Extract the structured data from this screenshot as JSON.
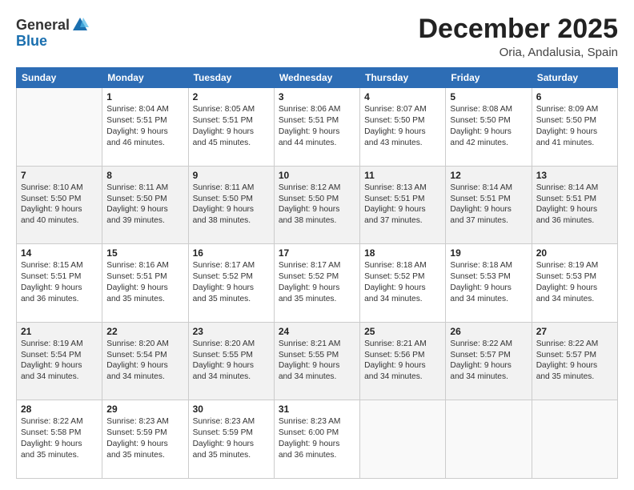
{
  "header": {
    "logo_general": "General",
    "logo_blue": "Blue",
    "month_title": "December 2025",
    "location": "Oria, Andalusia, Spain"
  },
  "weekdays": [
    "Sunday",
    "Monday",
    "Tuesday",
    "Wednesday",
    "Thursday",
    "Friday",
    "Saturday"
  ],
  "weeks": [
    [
      {
        "day": "",
        "content": ""
      },
      {
        "day": "1",
        "content": "Sunrise: 8:04 AM\nSunset: 5:51 PM\nDaylight: 9 hours\nand 46 minutes."
      },
      {
        "day": "2",
        "content": "Sunrise: 8:05 AM\nSunset: 5:51 PM\nDaylight: 9 hours\nand 45 minutes."
      },
      {
        "day": "3",
        "content": "Sunrise: 8:06 AM\nSunset: 5:51 PM\nDaylight: 9 hours\nand 44 minutes."
      },
      {
        "day": "4",
        "content": "Sunrise: 8:07 AM\nSunset: 5:50 PM\nDaylight: 9 hours\nand 43 minutes."
      },
      {
        "day": "5",
        "content": "Sunrise: 8:08 AM\nSunset: 5:50 PM\nDaylight: 9 hours\nand 42 minutes."
      },
      {
        "day": "6",
        "content": "Sunrise: 8:09 AM\nSunset: 5:50 PM\nDaylight: 9 hours\nand 41 minutes."
      }
    ],
    [
      {
        "day": "7",
        "content": "Sunrise: 8:10 AM\nSunset: 5:50 PM\nDaylight: 9 hours\nand 40 minutes."
      },
      {
        "day": "8",
        "content": "Sunrise: 8:11 AM\nSunset: 5:50 PM\nDaylight: 9 hours\nand 39 minutes."
      },
      {
        "day": "9",
        "content": "Sunrise: 8:11 AM\nSunset: 5:50 PM\nDaylight: 9 hours\nand 38 minutes."
      },
      {
        "day": "10",
        "content": "Sunrise: 8:12 AM\nSunset: 5:50 PM\nDaylight: 9 hours\nand 38 minutes."
      },
      {
        "day": "11",
        "content": "Sunrise: 8:13 AM\nSunset: 5:51 PM\nDaylight: 9 hours\nand 37 minutes."
      },
      {
        "day": "12",
        "content": "Sunrise: 8:14 AM\nSunset: 5:51 PM\nDaylight: 9 hours\nand 37 minutes."
      },
      {
        "day": "13",
        "content": "Sunrise: 8:14 AM\nSunset: 5:51 PM\nDaylight: 9 hours\nand 36 minutes."
      }
    ],
    [
      {
        "day": "14",
        "content": "Sunrise: 8:15 AM\nSunset: 5:51 PM\nDaylight: 9 hours\nand 36 minutes."
      },
      {
        "day": "15",
        "content": "Sunrise: 8:16 AM\nSunset: 5:51 PM\nDaylight: 9 hours\nand 35 minutes."
      },
      {
        "day": "16",
        "content": "Sunrise: 8:17 AM\nSunset: 5:52 PM\nDaylight: 9 hours\nand 35 minutes."
      },
      {
        "day": "17",
        "content": "Sunrise: 8:17 AM\nSunset: 5:52 PM\nDaylight: 9 hours\nand 35 minutes."
      },
      {
        "day": "18",
        "content": "Sunrise: 8:18 AM\nSunset: 5:52 PM\nDaylight: 9 hours\nand 34 minutes."
      },
      {
        "day": "19",
        "content": "Sunrise: 8:18 AM\nSunset: 5:53 PM\nDaylight: 9 hours\nand 34 minutes."
      },
      {
        "day": "20",
        "content": "Sunrise: 8:19 AM\nSunset: 5:53 PM\nDaylight: 9 hours\nand 34 minutes."
      }
    ],
    [
      {
        "day": "21",
        "content": "Sunrise: 8:19 AM\nSunset: 5:54 PM\nDaylight: 9 hours\nand 34 minutes."
      },
      {
        "day": "22",
        "content": "Sunrise: 8:20 AM\nSunset: 5:54 PM\nDaylight: 9 hours\nand 34 minutes."
      },
      {
        "day": "23",
        "content": "Sunrise: 8:20 AM\nSunset: 5:55 PM\nDaylight: 9 hours\nand 34 minutes."
      },
      {
        "day": "24",
        "content": "Sunrise: 8:21 AM\nSunset: 5:55 PM\nDaylight: 9 hours\nand 34 minutes."
      },
      {
        "day": "25",
        "content": "Sunrise: 8:21 AM\nSunset: 5:56 PM\nDaylight: 9 hours\nand 34 minutes."
      },
      {
        "day": "26",
        "content": "Sunrise: 8:22 AM\nSunset: 5:57 PM\nDaylight: 9 hours\nand 34 minutes."
      },
      {
        "day": "27",
        "content": "Sunrise: 8:22 AM\nSunset: 5:57 PM\nDaylight: 9 hours\nand 35 minutes."
      }
    ],
    [
      {
        "day": "28",
        "content": "Sunrise: 8:22 AM\nSunset: 5:58 PM\nDaylight: 9 hours\nand 35 minutes."
      },
      {
        "day": "29",
        "content": "Sunrise: 8:23 AM\nSunset: 5:59 PM\nDaylight: 9 hours\nand 35 minutes."
      },
      {
        "day": "30",
        "content": "Sunrise: 8:23 AM\nSunset: 5:59 PM\nDaylight: 9 hours\nand 35 minutes."
      },
      {
        "day": "31",
        "content": "Sunrise: 8:23 AM\nSunset: 6:00 PM\nDaylight: 9 hours\nand 36 minutes."
      },
      {
        "day": "",
        "content": ""
      },
      {
        "day": "",
        "content": ""
      },
      {
        "day": "",
        "content": ""
      }
    ]
  ]
}
